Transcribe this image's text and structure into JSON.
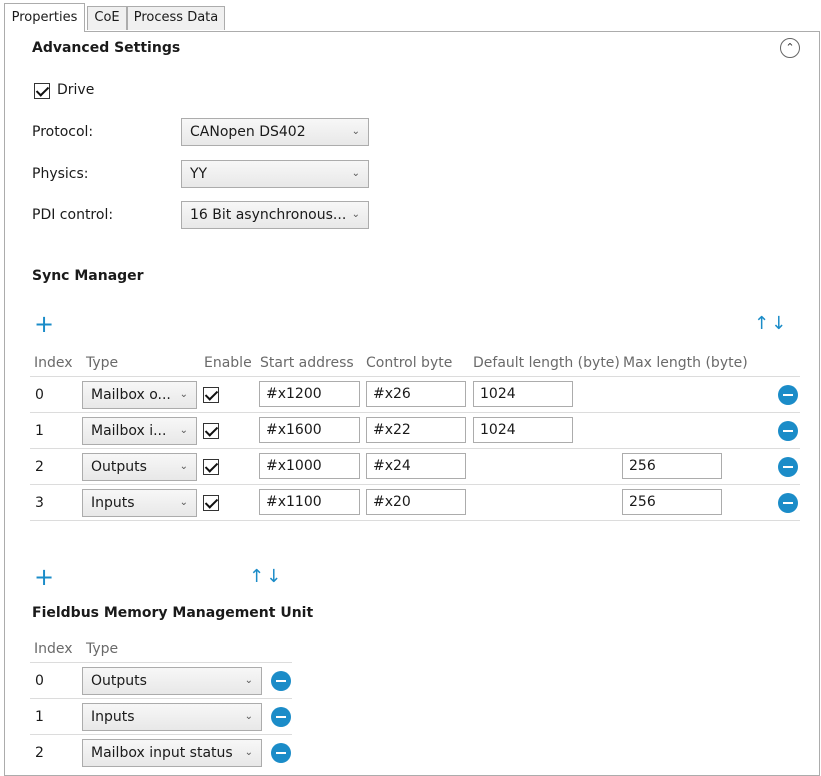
{
  "tabs": [
    {
      "label": "Properties"
    },
    {
      "label": "CoE"
    },
    {
      "label": "Process Data"
    }
  ],
  "advanced": {
    "title": "Advanced Settings",
    "drive_label": "Drive",
    "protocol_label": "Protocol:",
    "protocol_value": "CANopen DS402",
    "physics_label": "Physics:",
    "physics_value": "YY",
    "pdi_label": "PDI control:",
    "pdi_value": "16 Bit asynchronous..."
  },
  "sync": {
    "title": "Sync Manager",
    "headers": {
      "index": "Index",
      "type": "Type",
      "enable": "Enable",
      "start": "Start address",
      "control": "Control byte",
      "default_len": "Default length (byte)",
      "max_len": "Max length (byte)"
    },
    "rows": [
      {
        "index": "0",
        "type": "Mailbox o...",
        "start": "#x1200",
        "control": "#x26",
        "default_len": "1024",
        "max_len": ""
      },
      {
        "index": "1",
        "type": "Mailbox i...",
        "start": "#x1600",
        "control": "#x22",
        "default_len": "1024",
        "max_len": ""
      },
      {
        "index": "2",
        "type": "Outputs",
        "start": "#x1000",
        "control": "#x24",
        "default_len": "",
        "max_len": "256"
      },
      {
        "index": "3",
        "type": "Inputs",
        "start": "#x1100",
        "control": "#x20",
        "default_len": "",
        "max_len": "256"
      }
    ]
  },
  "fmmu": {
    "title": "Fieldbus Memory Management Unit",
    "headers": {
      "index": "Index",
      "type": "Type"
    },
    "rows": [
      {
        "index": "0",
        "type": "Outputs"
      },
      {
        "index": "1",
        "type": "Inputs"
      },
      {
        "index": "2",
        "type": "Mailbox input status"
      }
    ]
  },
  "icons": {
    "plus": "+",
    "up_down": "↑↓",
    "collapse": "⌃",
    "chevron": "⌄"
  },
  "colors": {
    "accent": "#1b8cc8"
  }
}
